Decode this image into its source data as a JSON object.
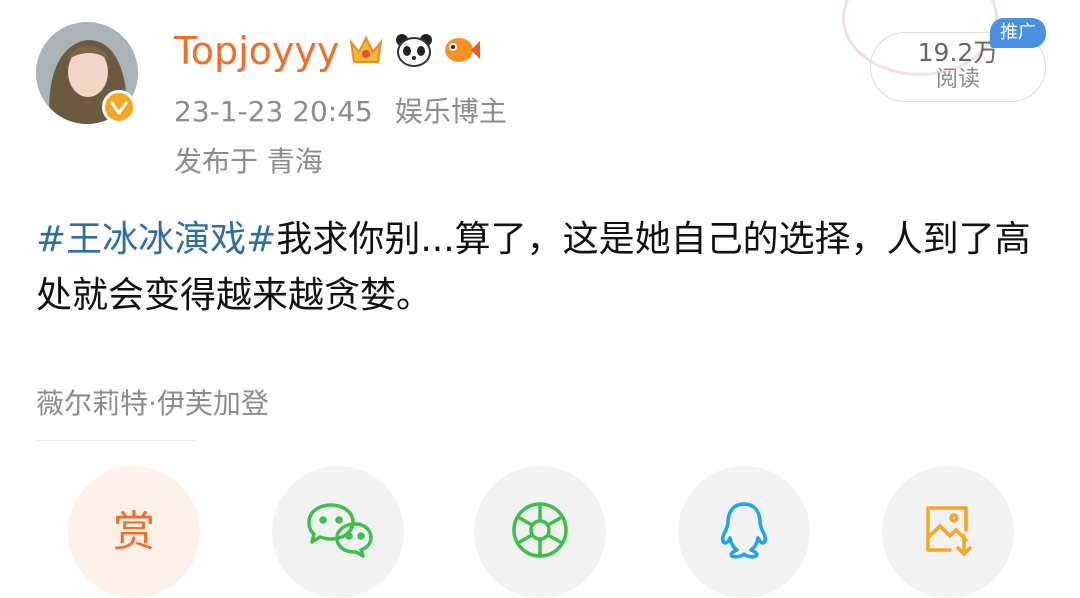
{
  "post": {
    "username": "Topjoyyy",
    "badges": [
      "crown-badge-icon",
      "panda-badge-icon",
      "fish-badge-icon"
    ],
    "date": "23-1-23 20:45",
    "category": "娱乐博主",
    "location": "发布于 青海",
    "hashtag": "#王冰冰演戏#",
    "body": "我求你别...算了，这是她自己的选择，人到了高处就会变得越来越贪婪。",
    "source": "薇尔莉特·伊芙加登"
  },
  "views": {
    "count": "19.2万",
    "label": "阅读"
  },
  "promo_label": "推广",
  "share": {
    "reward_label": "赏",
    "items": [
      "wechat-icon",
      "moments-icon",
      "qq-icon",
      "save-image-icon"
    ]
  },
  "colors": {
    "username": "#f06d2a",
    "hashtag": "#2f6ea5",
    "promo": "#4a90e2",
    "verified": "#f5a623",
    "wechat": "#3cbf4b",
    "qq": "#1fa3f0"
  }
}
